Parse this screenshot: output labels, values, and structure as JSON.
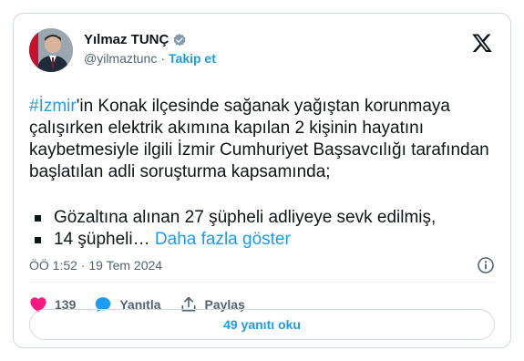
{
  "author": {
    "display_name": "Yılmaz TUNÇ",
    "handle": "@yilmaztunc",
    "separator": "·",
    "follow_label": "Takip et"
  },
  "tweet": {
    "hashtag": "#İzmir",
    "body": "'in Konak ilçesinde sağanak yağıştan korunmaya çalışırken elektrik akımına kapılan 2 kişinin hayatını kaybetmesiyle ilgili İzmir Cumhuriyet Başsavcılığı tarafından başlatılan adli soruşturma kapsamında;",
    "bullet_1": "Gözaltına alınan 27 şüpheli adliyeye sevk edilmiş,",
    "bullet_2": "14 şüpheli…",
    "show_more": "Daha fazla göster"
  },
  "meta": {
    "timestamp": "ÖÖ 1:52 · 19 Tem 2024"
  },
  "actions": {
    "likes": "139",
    "reply_label": "Yanıtla",
    "share_label": "Paylaş"
  },
  "replies_button": "49 yanıtı oku",
  "colors": {
    "accent": "#1d9bf0",
    "like": "#f91880",
    "text": "#0f1419",
    "muted": "#536471"
  }
}
